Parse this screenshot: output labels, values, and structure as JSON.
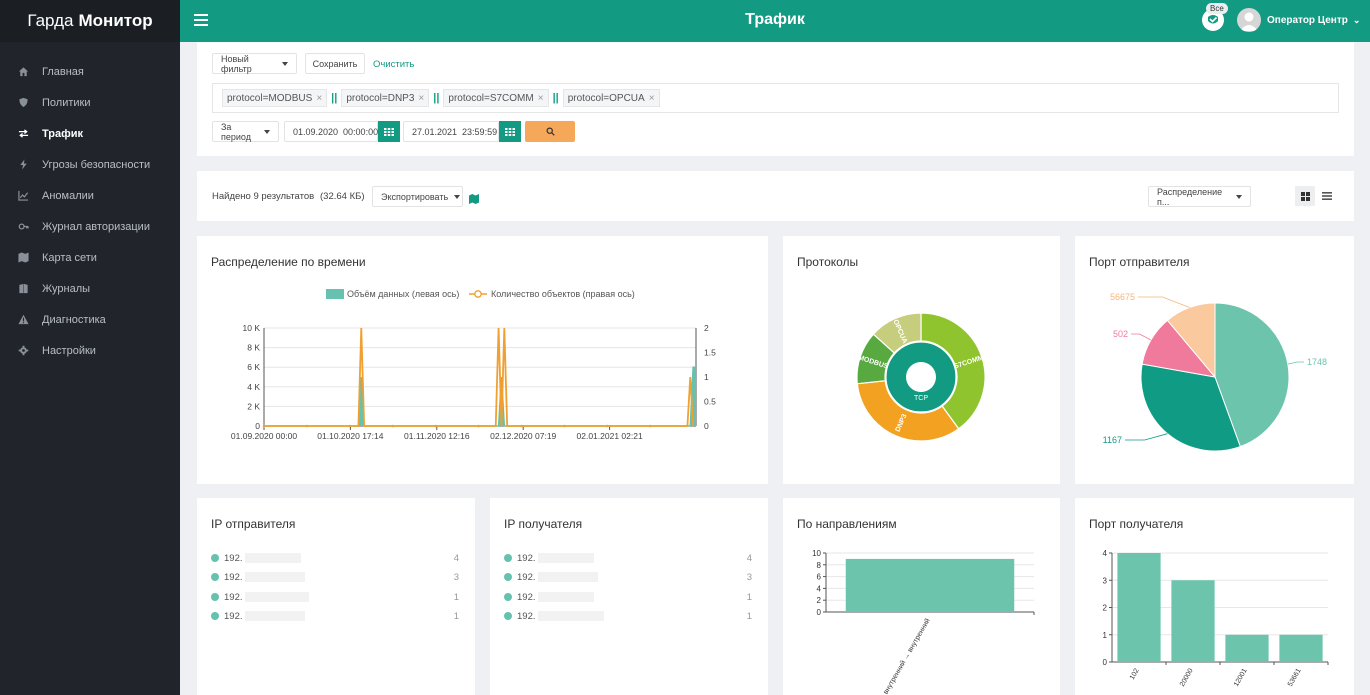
{
  "brand": {
    "prefix": "Гарда",
    "name": "Монитор"
  },
  "header": {
    "title": "Трафик",
    "badge": "Все",
    "user": "Оператор Центр"
  },
  "sidebar": {
    "items": [
      {
        "label": "Главная",
        "icon": "home-icon"
      },
      {
        "label": "Политики",
        "icon": "shield-icon"
      },
      {
        "label": "Трафик",
        "icon": "exchange-icon",
        "active": true
      },
      {
        "label": "Угрозы безопасности",
        "icon": "bolt-icon"
      },
      {
        "label": "Аномалии",
        "icon": "line-chart-icon"
      },
      {
        "label": "Журнал авторизации",
        "icon": "key-icon"
      },
      {
        "label": "Карта сети",
        "icon": "map-icon"
      },
      {
        "label": "Журналы",
        "icon": "books-icon"
      },
      {
        "label": "Диагностика",
        "icon": "warning-icon"
      },
      {
        "label": "Настройки",
        "icon": "gear-icon"
      }
    ]
  },
  "filter": {
    "new_filter": "Новый фильтр",
    "save": "Сохранить",
    "clear": "Очистить",
    "tags": [
      "protocol=MODBUS",
      "protocol=DNP3",
      "protocol=S7COMM",
      "protocol=OPCUA"
    ],
    "separator": "||",
    "period_label": "За период",
    "date_from": "01.09.2020  00:00:00",
    "date_to": "27.01.2021  23:59:59"
  },
  "results": {
    "found": "Найдено 9 результатов",
    "size": "(32.64 КБ)",
    "export": "Экспортировать",
    "distribution": "Распределение п..."
  },
  "colors": {
    "accent": "#139a82",
    "search_button": "#f5a75a",
    "teal": "#66c2ae",
    "orange": "#f0a030"
  },
  "cards": {
    "time": "Распределение по времени",
    "protocols": "Протоколы",
    "src_port": "Порт отправителя",
    "src_ip": "IP отправителя",
    "dst_ip": "IP получателя",
    "directions": "По направлениям",
    "dst_port": "Порт получателя"
  },
  "src_ip": [
    {
      "ip": "192.",
      "count": "4"
    },
    {
      "ip": "192.",
      "count": "3"
    },
    {
      "ip": "192.",
      "count": "1"
    },
    {
      "ip": "192.",
      "count": "1"
    }
  ],
  "dst_ip": [
    {
      "ip": "192.",
      "count": "4"
    },
    {
      "ip": "192.",
      "count": "3"
    },
    {
      "ip": "192.",
      "count": "1"
    },
    {
      "ip": "192.",
      "count": "1"
    }
  ],
  "chart_data": [
    {
      "type": "line",
      "title": "Распределение по времени",
      "legend": [
        "Объём данных (левая ось)",
        "Количество объектов (правая ось)"
      ],
      "x_ticks": [
        "01.09.2020 00:00",
        "01.10.2020 17:14",
        "01.11.2020 12:16",
        "02.12.2020 07:19",
        "02.01.2021 02:21"
      ],
      "y_left_ticks": [
        "0",
        "2 K",
        "4 K",
        "6 K",
        "8 K",
        "10 K"
      ],
      "y_right_ticks": [
        "0",
        "0.5",
        "1",
        "1.5",
        "2"
      ],
      "ylim_left": [
        0,
        10000
      ],
      "ylim_right": [
        0,
        2
      ],
      "x_range": [
        0,
        148
      ],
      "series": [
        {
          "name": "Объём данных (левая ось)",
          "axis": "left",
          "points": [
            [
              0,
              0
            ],
            [
              33,
              0
            ],
            [
              34,
              5000
            ],
            [
              35,
              0
            ],
            [
              82,
              0
            ],
            [
              83,
              5000
            ],
            [
              84,
              0
            ],
            [
              149,
              0
            ],
            [
              150,
              6000
            ],
            [
              151,
              6000
            ]
          ]
        },
        {
          "name": "Количество объектов (правая ось)",
          "axis": "right",
          "points": [
            [
              0,
              0
            ],
            [
              33,
              0
            ],
            [
              34,
              2
            ],
            [
              35,
              0
            ],
            [
              81,
              0
            ],
            [
              82,
              2
            ],
            [
              83,
              0
            ],
            [
              84,
              2
            ],
            [
              85,
              0
            ],
            [
              148,
              0
            ],
            [
              149,
              1
            ],
            [
              150,
              0
            ]
          ]
        }
      ]
    },
    {
      "type": "pie",
      "title": "Протоколы",
      "inner": [
        {
          "label": "TCP",
          "value": 9
        }
      ],
      "slices": [
        {
          "label": "S7COMM",
          "value": 3
        },
        {
          "label": "DNP3",
          "value": 2.5
        },
        {
          "label": "MODBUS",
          "value": 1
        },
        {
          "label": "OPCUA",
          "value": 1
        }
      ]
    },
    {
      "type": "pie",
      "title": "Порт отправителя",
      "slices": [
        {
          "label": "1748",
          "value": 4
        },
        {
          "label": "1167",
          "value": 3
        },
        {
          "label": "502",
          "value": 1
        },
        {
          "label": "56675",
          "value": 1
        }
      ]
    },
    {
      "type": "bar",
      "title": "По направлениям",
      "categories": [
        "внутренний → внутренний"
      ],
      "values": [
        9
      ],
      "ylim": [
        0,
        10
      ],
      "y_ticks": [
        "0",
        "2",
        "4",
        "6",
        "8",
        "10"
      ]
    },
    {
      "type": "bar",
      "title": "Порт получателя",
      "categories": [
        "102",
        "20000",
        "12001",
        "53661"
      ],
      "values": [
        4,
        3,
        1,
        1
      ],
      "ylim": [
        0,
        4
      ],
      "y_ticks": [
        "0",
        "1",
        "2",
        "3",
        "4"
      ]
    }
  ]
}
